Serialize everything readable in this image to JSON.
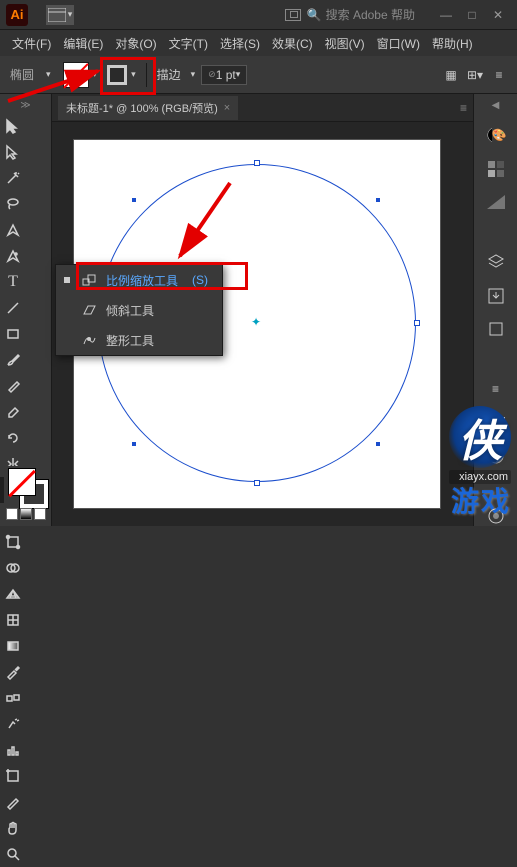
{
  "app": {
    "logo": "Ai"
  },
  "titlebar": {
    "search_placeholder": "搜索 Adobe 帮助",
    "win": {
      "min": "—",
      "max": "□",
      "close": "✕"
    }
  },
  "menu": {
    "file": "文件(F)",
    "edit": "编辑(E)",
    "object": "对象(O)",
    "type": "文字(T)",
    "select": "选择(S)",
    "effect": "效果(C)",
    "view": "视图(V)",
    "window": "窗口(W)",
    "help": "帮助(H)"
  },
  "controlbar": {
    "tool_label": "椭圆",
    "stroke_label": "描边",
    "stroke_value": "1 pt",
    "caret": "▾"
  },
  "document": {
    "tab_title": "未标题-1* @ 100% (RGB/预览)",
    "tab_close": "×"
  },
  "flyout": {
    "scale": {
      "label": "比例缩放工具",
      "shortcut": "(S)"
    },
    "shear": {
      "label": "倾斜工具"
    },
    "reshape": {
      "label": "整形工具"
    }
  },
  "watermark": {
    "char": "侠",
    "url": "xiayx.com",
    "word": "游戏"
  },
  "chart_data": {
    "type": "diagram",
    "shape": "circle",
    "stroke_color": "#1a4dcc",
    "fill": "none",
    "canvas_bg": "#ffffff",
    "selected": true
  }
}
